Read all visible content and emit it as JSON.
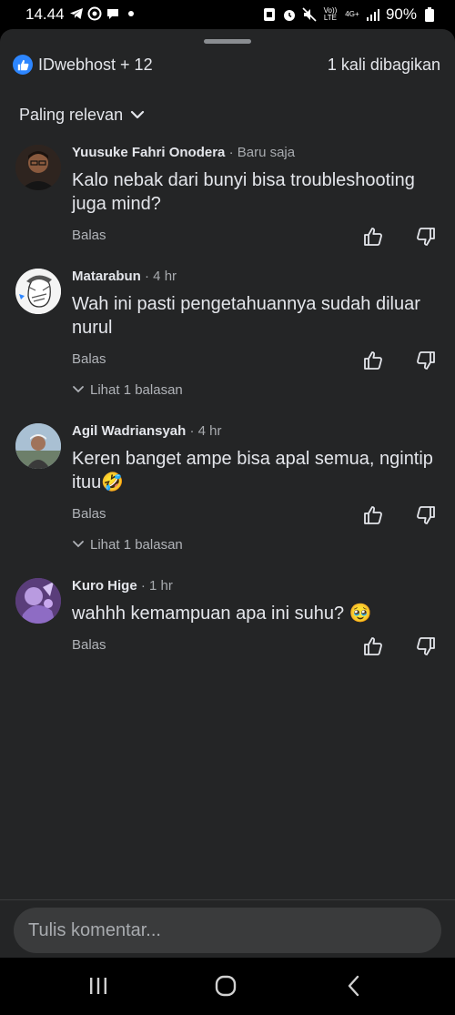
{
  "status_bar": {
    "time": "14.44",
    "network": "4G+",
    "volte": "Vo)) LTE",
    "battery": "90%"
  },
  "header": {
    "reactions": "IDwebhost + 12",
    "shares": "1 kali dibagikan"
  },
  "sort": {
    "label": "Paling relevan"
  },
  "comments": [
    {
      "name": "Yuusuke Fahri Onodera",
      "time": "· Baru saja",
      "text": "Kalo nebak dari bunyi bisa troubleshooting juga mind?",
      "reply": "Balas",
      "view_replies": ""
    },
    {
      "name": "Matarabun",
      "time": "· 4 hr",
      "text": "Wah ini pasti pengetahuannya sudah diluar nurul",
      "reply": "Balas",
      "view_replies": "Lihat 1 balasan"
    },
    {
      "name": "Agil Wadriansyah",
      "time": "· 4 hr",
      "text": "Keren banget ampe bisa apal semua, ngintip ituu🤣",
      "reply": "Balas",
      "view_replies": "Lihat 1 balasan"
    },
    {
      "name": "Kuro Hige",
      "time": "· 1 hr",
      "text": "wahhh kemampuan apa ini suhu? 🥹",
      "reply": "Balas",
      "view_replies": ""
    }
  ],
  "composer": {
    "placeholder": "Tulis komentar..."
  }
}
